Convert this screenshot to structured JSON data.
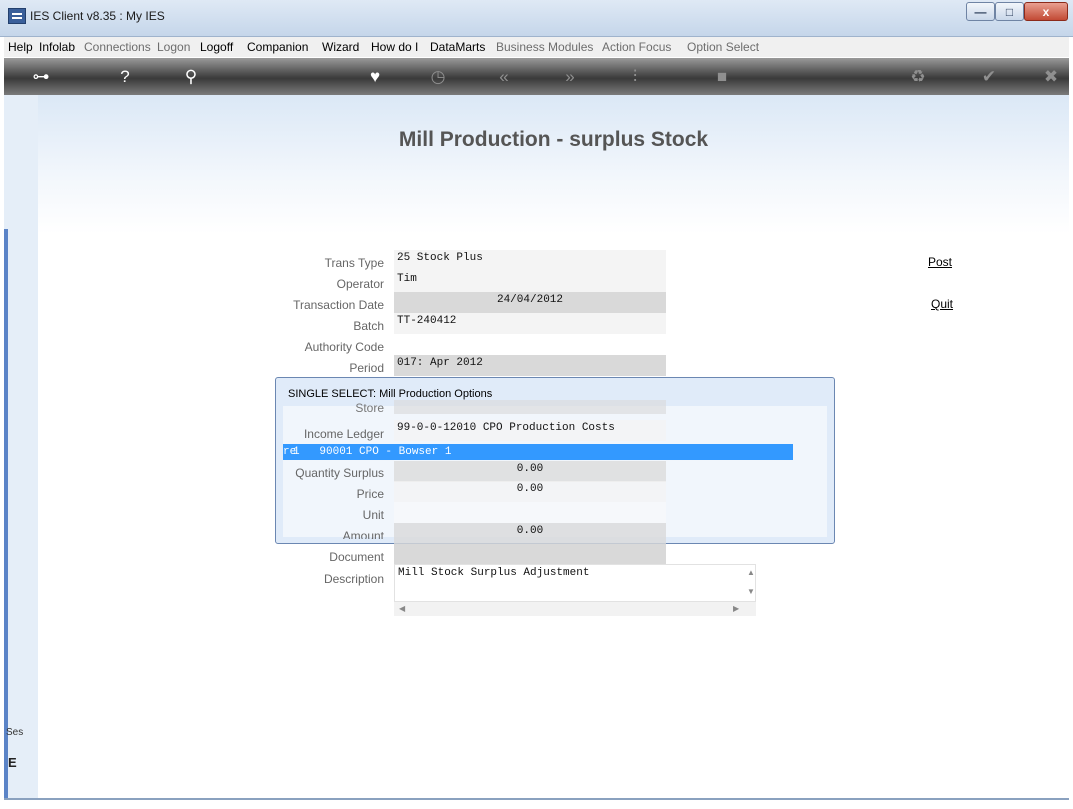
{
  "window": {
    "title": "IES Client v8.35 : My IES",
    "min_glyph": "—",
    "max_glyph": "□",
    "close_glyph": "x"
  },
  "menu": [
    {
      "label": "Help",
      "enabled": true
    },
    {
      "label": "Infolab",
      "enabled": true
    },
    {
      "label": "Connections",
      "enabled": false
    },
    {
      "label": "Logon",
      "enabled": false
    },
    {
      "label": "Logoff",
      "enabled": true
    },
    {
      "label": "Companion",
      "enabled": true
    },
    {
      "label": "Wizard",
      "enabled": true
    },
    {
      "label": "How do I",
      "enabled": true
    },
    {
      "label": "DataMarts",
      "enabled": true
    },
    {
      "label": "Business Modules",
      "enabled": false
    },
    {
      "label": "Action Focus",
      "enabled": false
    },
    {
      "label": "Option Select",
      "enabled": false
    }
  ],
  "toolbar": [
    {
      "icon": "key-icon",
      "glyph": "⊶"
    },
    {
      "icon": "help-icon",
      "glyph": "?"
    },
    {
      "icon": "search-icon",
      "glyph": "⚲"
    },
    {
      "icon": "heart-icon",
      "glyph": "♥"
    },
    {
      "icon": "clock-icon",
      "glyph": "◷"
    },
    {
      "icon": "rewind-icon",
      "glyph": "«"
    },
    {
      "icon": "forward-icon",
      "glyph": "»"
    },
    {
      "icon": "tree-icon",
      "glyph": "⫶"
    },
    {
      "icon": "stop-icon",
      "glyph": "■"
    },
    {
      "icon": "recycle-icon",
      "glyph": "♻"
    },
    {
      "icon": "check-icon",
      "glyph": "✔"
    },
    {
      "icon": "close-icon",
      "glyph": "✖"
    }
  ],
  "page": {
    "title": "Mill Production - surplus Stock"
  },
  "form": {
    "trans_type": {
      "label": "Trans Type",
      "value": "25 Stock Plus"
    },
    "operator": {
      "label": "Operator",
      "value": "Tim"
    },
    "transaction_date": {
      "label": "Transaction Date",
      "value": "24/04/2012"
    },
    "batch": {
      "label": "Batch",
      "value": "TT-240412"
    },
    "authority_code": {
      "label": "Authority Code",
      "value": ""
    },
    "period": {
      "label": "Period",
      "value": "017: Apr 2012"
    },
    "store": {
      "label": "Store",
      "value": ""
    },
    "income_ledger": {
      "label": "Income Ledger",
      "value": "99-0-0-12010 CPO Production Costs"
    },
    "quantity_surplus": {
      "label": "Quantity Surplus",
      "value": "0.00"
    },
    "price": {
      "label": "Price",
      "value": "0.00"
    },
    "unit": {
      "label": "Unit",
      "value": ""
    },
    "amount": {
      "label": "Amount",
      "value": "0.00"
    },
    "document": {
      "label": "Document",
      "value": ""
    },
    "description": {
      "label": "Description",
      "value": "Mill Stock Surplus Adjustment"
    }
  },
  "actions": {
    "post": "Post",
    "quit": "Quit"
  },
  "popup": {
    "title": "SINGLE SELECT: Mill Production Options",
    "selected_prefix": "re",
    "selected_row": "1   90001 CPO - Bowser 1"
  },
  "sidebar": {
    "session_label": "Ses",
    "session_icon": "E"
  }
}
